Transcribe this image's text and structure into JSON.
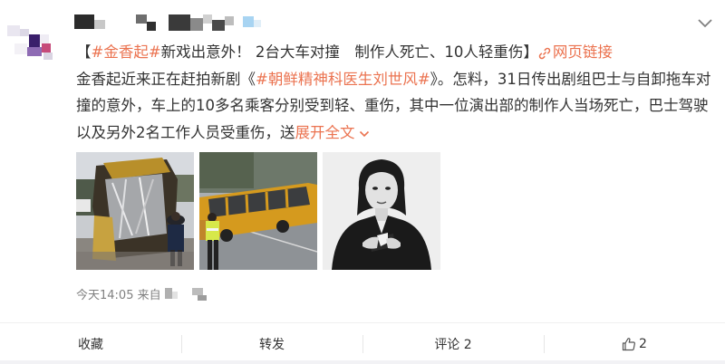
{
  "post": {
    "title_tag": "#金香起#",
    "title_text": "新戏出意外！ 2台大车对撞　制作人死亡、10人轻重伤】",
    "title_open": "【",
    "weblink_label": "网页链接",
    "body_line1": "金香起近来正在赶拍新剧《",
    "body_topic": "#朝鲜精神科医生刘世风#",
    "body_line1_end": "》。怎料，31日传出剧组巴士与自卸拖车对",
    "body_line2": "撞的意外，车上的10多名乘客分别受到轻、重伤，其中一位演出部的制作人当场死亡，巴士驾驶",
    "body_line3": "以及另外2名工作人员受重伤，送",
    "expand_label": "展开全文",
    "time": "今天14:05",
    "source_prefix": "来自"
  },
  "photos": [
    {
      "name": "crash-bus-wreck-photo"
    },
    {
      "name": "crash-yellow-bus-photo"
    },
    {
      "name": "actress-portrait-photo"
    }
  ],
  "actions": {
    "favorite_label": "收藏",
    "repost_label": "转发",
    "comment_label": "评论 2",
    "like_count": "2"
  },
  "colors": {
    "accent": "#eb7350",
    "text": "#333333",
    "meta": "#808080"
  },
  "icons": {
    "menu": "chevron-down-icon",
    "weblink": "link-icon",
    "expand": "chevron-down-icon",
    "like": "thumbs-up-icon"
  }
}
